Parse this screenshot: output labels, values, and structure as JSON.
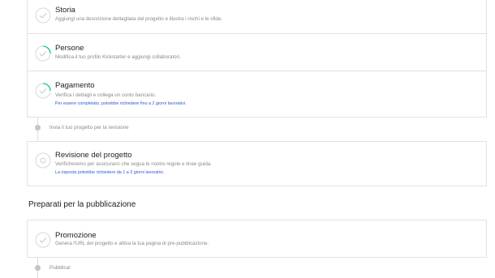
{
  "steps": [
    {
      "title": "Storia",
      "description": "Aggiungi una descrizione dettagliata del progetto e illustra i rischi e le sfide.",
      "status": "complete"
    },
    {
      "title": "Persone",
      "description": "Modifica il tuo profilo Kickstarter e aggiungi collaboratori.",
      "status": "in-progress"
    },
    {
      "title": "Pagamento",
      "description": "Verifica i dettagli e collega un conto bancario.",
      "note": "Per essere completato, potrebbe richiedere fino a 2 giorni lavorativi.",
      "status": "in-progress"
    }
  ],
  "submit_label": "Invia il tuo progetto per la revisione",
  "review": {
    "title": "Revisione del progetto",
    "description": "Verificheremo per assicurarci che segua le nostre regole e linee guida.",
    "note": "La risposta potrebbe richiedere da 1 a 3 giorni lavorativi.",
    "status": "pending"
  },
  "prepare_heading": "Preparati per la pubblicazione",
  "promotion": {
    "title": "Promozione",
    "description": "Genera l'URL del progetto e attiva la tua pagina di pre-pubblicazione.",
    "status": "complete"
  },
  "publish_label": "Pubblica!",
  "colors": {
    "accent_green": "#05ce78",
    "link_blue": "#2a5bd7",
    "border": "#e2e2e2"
  }
}
